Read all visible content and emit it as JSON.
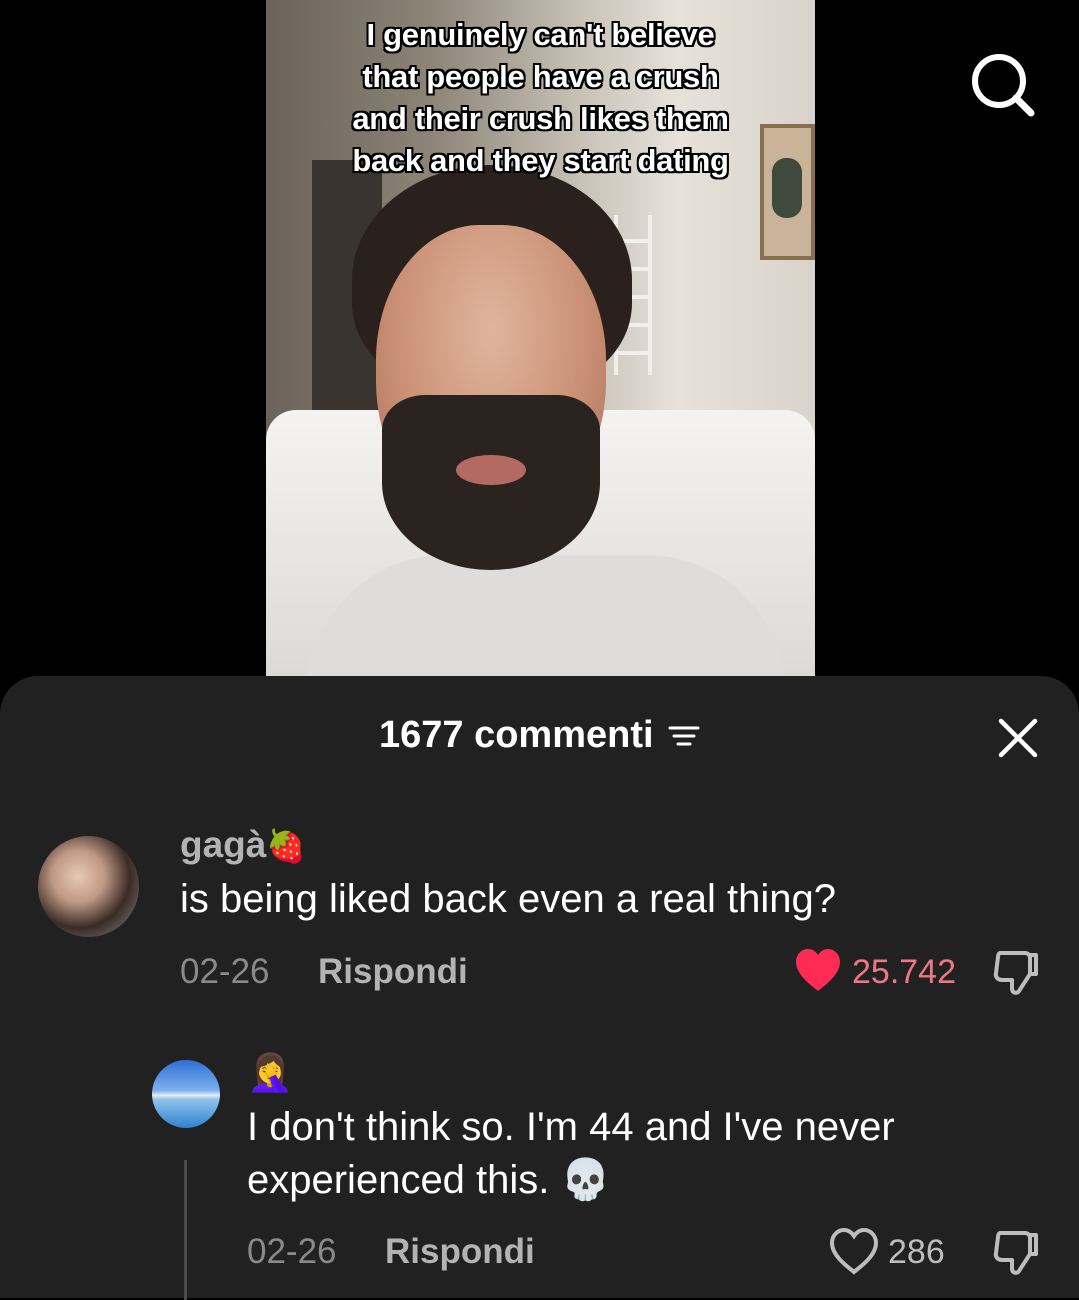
{
  "video": {
    "caption": "I genuinely can't believe\nthat people have a crush\nand their crush likes them\nback and they start dating"
  },
  "icons": {
    "search": "search-icon",
    "close": "close-icon",
    "filter": "filter-icon",
    "heart_filled": "heart-filled-icon",
    "heart_outline": "heart-outline-icon",
    "dislike": "thumbs-down-icon"
  },
  "colors": {
    "sheet_bg": "#212121",
    "like_red": "#fe2c55",
    "like_count_red": "#f07685"
  },
  "comments_header": {
    "count_label": "1677 commenti"
  },
  "comments": [
    {
      "username": "gagà",
      "username_emoji": "🍓",
      "text": "is being liked back even a real thing?",
      "date": "02-26",
      "reply_label": "Rispondi",
      "likes": "25.742",
      "liked": true
    },
    {
      "username_emoji": "🤦‍♀️",
      "text": "I don't think so. I'm 44 and I've never\nexperienced this. 💀",
      "date": "02-26",
      "reply_label": "Rispondi",
      "likes": "286",
      "liked": false
    }
  ]
}
